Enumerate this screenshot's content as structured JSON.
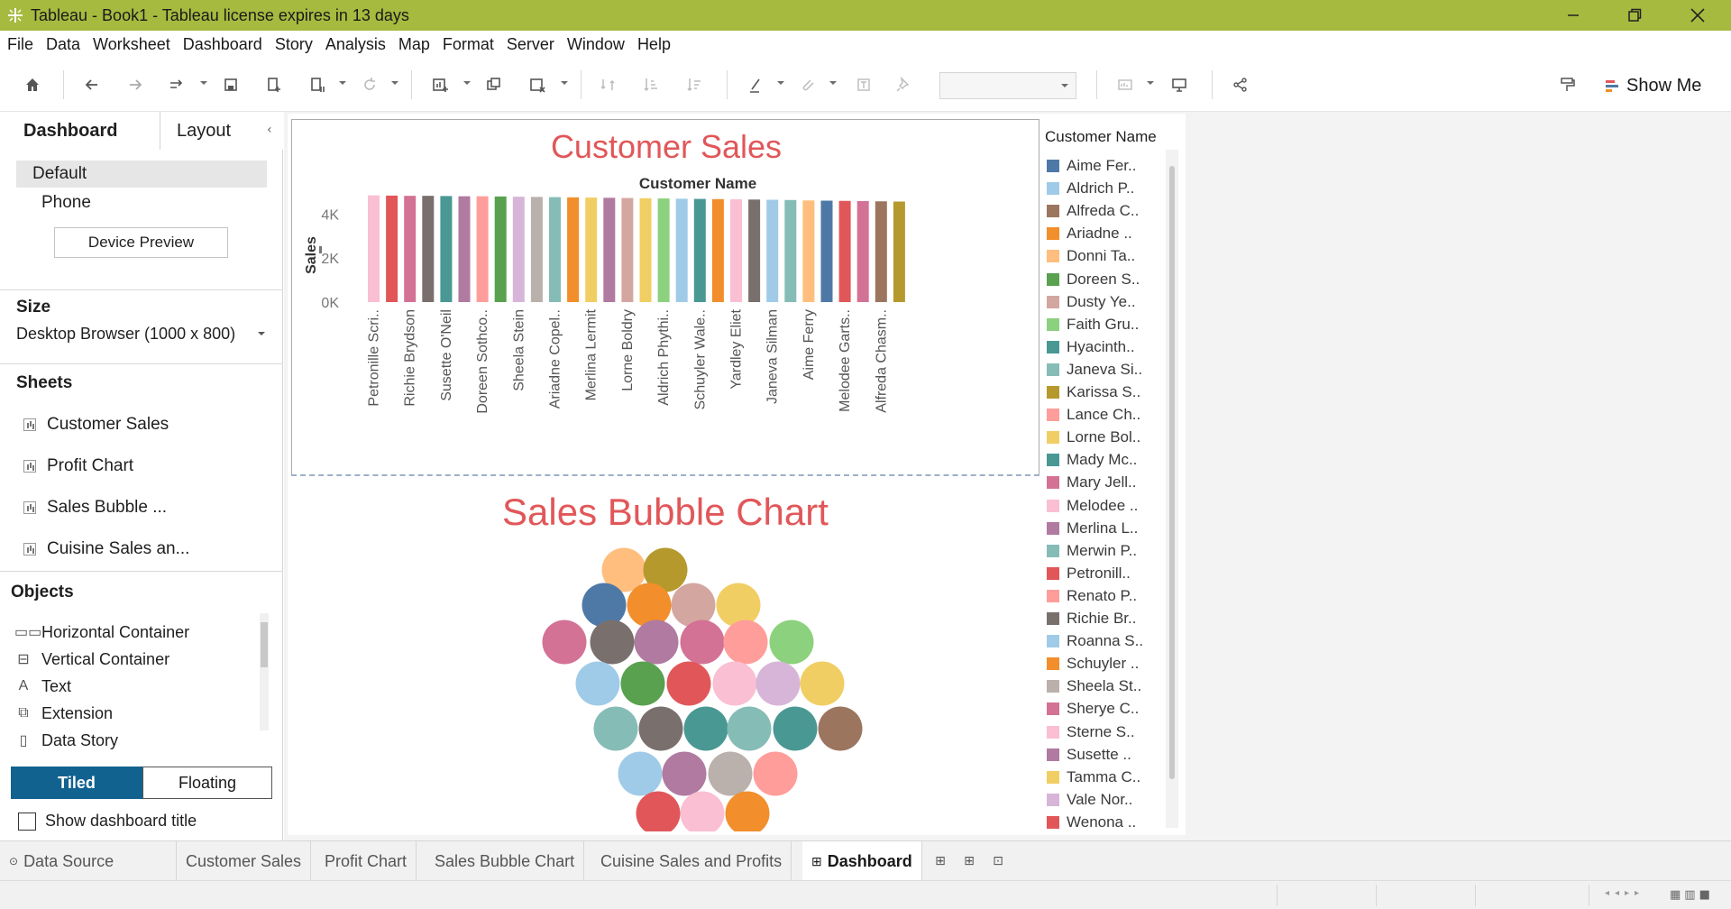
{
  "window": {
    "title": "Tableau - Book1 - Tableau license expires in 13 days",
    "accent": "#a6ba3f"
  },
  "menu": [
    "File",
    "Data",
    "Worksheet",
    "Dashboard",
    "Story",
    "Analysis",
    "Map",
    "Format",
    "Server",
    "Window",
    "Help"
  ],
  "toolbar": {
    "show_me": "Show Me",
    "icons": [
      "home-icon",
      "undo-icon",
      "redo-icon",
      "replay-icon",
      "save-icon",
      "new-data-source-icon",
      "pause-updates-icon",
      "refresh-icon",
      "new-worksheet-icon",
      "duplicate-icon",
      "clear-icon",
      "swap-icon",
      "sort-ascending-icon",
      "sort-descending-icon",
      "highlight-icon",
      "group-icon",
      "label-icon",
      "pin-icon",
      "fit-select",
      "show-cards-icon",
      "presentation-icon",
      "share-icon",
      "format-painter-icon"
    ]
  },
  "left_pane": {
    "tabs": {
      "dashboard": "Dashboard",
      "layout": "Layout"
    },
    "devices": {
      "default": "Default",
      "phone": "Phone",
      "preview_button": "Device Preview"
    },
    "size": {
      "heading": "Size",
      "value": "Desktop Browser (1000 x 800)"
    },
    "sheets": {
      "heading": "Sheets",
      "items": [
        "Customer Sales",
        "Profit Chart",
        "Sales Bubble ...",
        "Cuisine Sales an..."
      ]
    },
    "objects": {
      "heading": "Objects",
      "items": [
        "Horizontal Container",
        "Vertical Container",
        "Text",
        "Extension",
        "Data Story"
      ]
    },
    "tiled": "Tiled",
    "floating": "Floating",
    "show_title": "Show dashboard title"
  },
  "dashboard": {
    "sales_title": "Customer Sales",
    "bubble_title": "Sales Bubble Chart",
    "legend_title": "Customer Name",
    "legend_items": [
      {
        "label": "Aime Fer..",
        "color": "#4e79a7"
      },
      {
        "label": "Aldrich P..",
        "color": "#a0cbe8"
      },
      {
        "label": "Alfreda C..",
        "color": "#9c755f"
      },
      {
        "label": "Ariadne ..",
        "color": "#f28e2b"
      },
      {
        "label": "Donni Ta..",
        "color": "#ffbe7d"
      },
      {
        "label": "Doreen S..",
        "color": "#59a14f"
      },
      {
        "label": "Dusty Ye..",
        "color": "#d4a6a0"
      },
      {
        "label": "Faith Gru..",
        "color": "#8cd17d"
      },
      {
        "label": "Hyacinth..",
        "color": "#499894"
      },
      {
        "label": "Janeva Si..",
        "color": "#86bcb6"
      },
      {
        "label": "Karissa S..",
        "color": "#b6992d"
      },
      {
        "label": "Lance Ch..",
        "color": "#ff9d9a"
      },
      {
        "label": "Lorne Bol..",
        "color": "#f1ce63"
      },
      {
        "label": "Mady Mc..",
        "color": "#499894"
      },
      {
        "label": "Mary Jell..",
        "color": "#d37295"
      },
      {
        "label": "Melodee ..",
        "color": "#fabfd2"
      },
      {
        "label": "Merlina L..",
        "color": "#b07aa1"
      },
      {
        "label": "Merwin P..",
        "color": "#86bcb6"
      },
      {
        "label": "Petronill..",
        "color": "#e15759"
      },
      {
        "label": "Renato P..",
        "color": "#ff9d9a"
      },
      {
        "label": "Richie Br..",
        "color": "#79706e"
      },
      {
        "label": "Roanna S..",
        "color": "#a0cbe8"
      },
      {
        "label": "Schuyler ..",
        "color": "#f28e2b"
      },
      {
        "label": "Sheela St..",
        "color": "#bab0ac"
      },
      {
        "label": "Sherye C..",
        "color": "#d37295"
      },
      {
        "label": "Sterne S..",
        "color": "#fabfd2"
      },
      {
        "label": "Susette ..",
        "color": "#b07aa1"
      },
      {
        "label": "Tamma C..",
        "color": "#f1ce63"
      },
      {
        "label": "Vale Nor..",
        "color": "#d7b5d8"
      },
      {
        "label": "Wenona ..",
        "color": "#e15759"
      }
    ]
  },
  "chart_data": [
    {
      "type": "bar",
      "title": "Customer Sales",
      "column_header": "Customer Name",
      "ylabel": "Sales",
      "y_ticks": [
        "0K",
        "2K",
        "4K"
      ],
      "ylim": [
        0,
        5000
      ],
      "categories": [
        "Petronille Scri..",
        "",
        "Richie Brydson",
        "",
        "Susette O'Neil",
        "",
        "Doreen Sothco..",
        "",
        "Sheela Stein",
        "",
        "Ariadne Copel..",
        "",
        "Merlina Lermit",
        "",
        "Lorne Boldry",
        "",
        "Aldrich Phythi..",
        "",
        "Schuyler Wale..",
        "",
        "Yardley Eliet",
        "",
        "Janeva Silman",
        "",
        "Aime Ferry",
        "",
        "Melodee Garts..",
        "",
        "Alfreda Chasm..",
        ""
      ],
      "values": [
        4850,
        4840,
        4830,
        4830,
        4820,
        4810,
        4810,
        4800,
        4790,
        4780,
        4770,
        4760,
        4750,
        4740,
        4730,
        4720,
        4710,
        4700,
        4690,
        4680,
        4670,
        4660,
        4650,
        4640,
        4620,
        4610,
        4600,
        4590,
        4580,
        4570
      ],
      "colors": [
        "#fabfd2",
        "#e15759",
        "#d37295",
        "#79706e",
        "#499894",
        "#b07aa1",
        "#ff9d9a",
        "#59a14f",
        "#d7b5d8",
        "#bab0ac",
        "#86bcb6",
        "#f28e2b",
        "#f1ce63",
        "#b07aa1",
        "#d4a6a0",
        "#f1ce63",
        "#8cd17d",
        "#a0cbe8",
        "#499894",
        "#f28e2b",
        "#fabfd2",
        "#79706e",
        "#a0cbe8",
        "#86bcb6",
        "#ffbe7d",
        "#4e79a7",
        "#e15759",
        "#d37295",
        "#9c755f",
        "#b6992d"
      ]
    },
    {
      "type": "bubble",
      "title": "Sales Bubble Chart",
      "bubbles": [
        {
          "color": "#ffbe7d"
        },
        {
          "color": "#b6992d"
        },
        {
          "color": "#4e79a7"
        },
        {
          "color": "#f28e2b"
        },
        {
          "color": "#d4a6a0"
        },
        {
          "color": "#f1ce63"
        },
        {
          "color": "#d37295"
        },
        {
          "color": "#79706e"
        },
        {
          "color": "#b07aa1"
        },
        {
          "color": "#d37295"
        },
        {
          "color": "#ff9d9a"
        },
        {
          "color": "#8cd17d"
        },
        {
          "color": "#a0cbe8"
        },
        {
          "color": "#59a14f"
        },
        {
          "color": "#e15759"
        },
        {
          "color": "#fabfd2"
        },
        {
          "color": "#d7b5d8"
        },
        {
          "color": "#f1ce63"
        },
        {
          "color": "#86bcb6"
        },
        {
          "color": "#79706e"
        },
        {
          "color": "#499894"
        },
        {
          "color": "#86bcb6"
        },
        {
          "color": "#499894"
        },
        {
          "color": "#9c755f"
        },
        {
          "color": "#a0cbe8"
        },
        {
          "color": "#b07aa1"
        },
        {
          "color": "#bab0ac"
        },
        {
          "color": "#ff9d9a"
        },
        {
          "color": "#e15759"
        },
        {
          "color": "#fabfd2"
        },
        {
          "color": "#f28e2b"
        }
      ]
    }
  ],
  "bottom_tabs": {
    "data_source": "Data Source",
    "sheets": [
      "Customer Sales",
      "Profit Chart",
      "Sales Bubble Chart",
      "Cuisine Sales and Profits"
    ],
    "active": "Dashboard"
  }
}
